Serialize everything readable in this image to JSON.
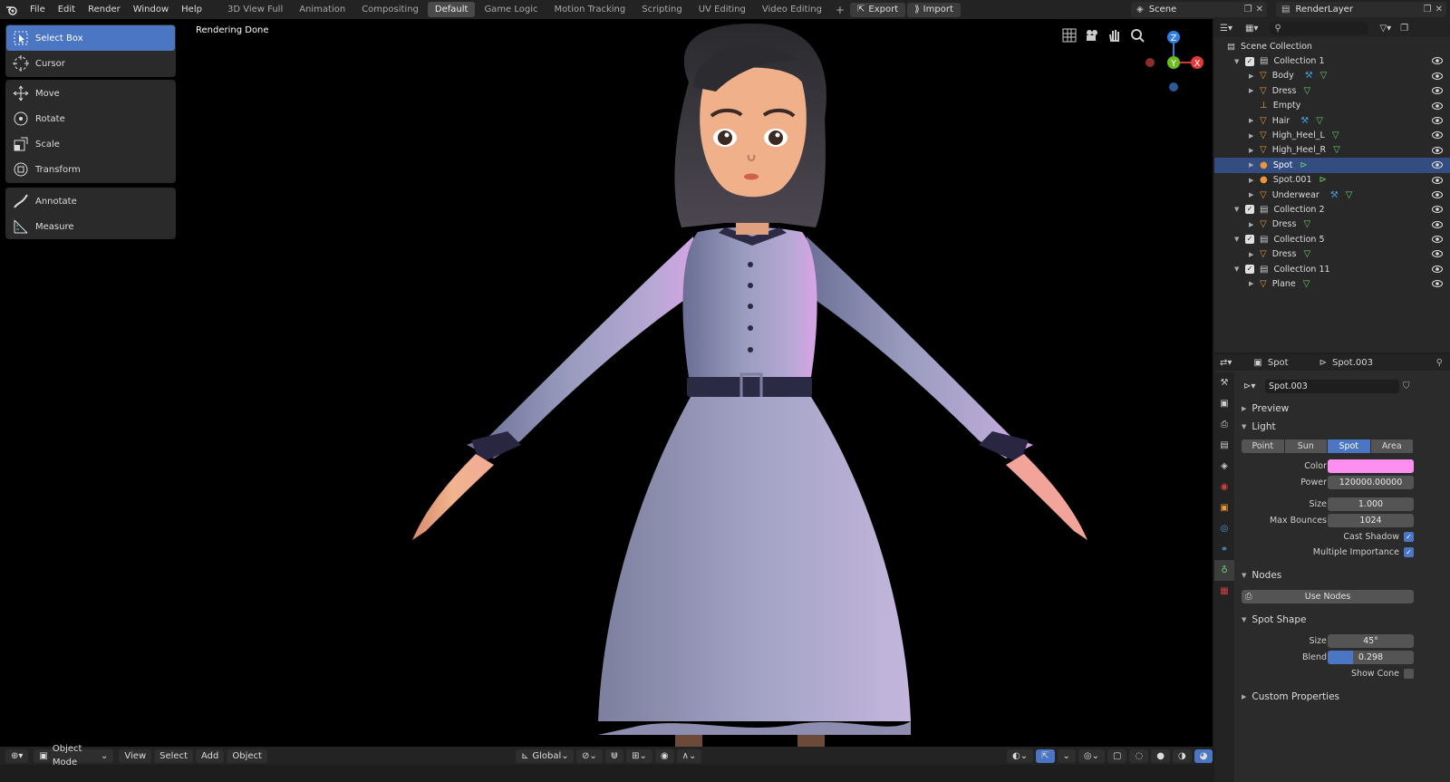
{
  "menubar": {
    "items": [
      "File",
      "Edit",
      "Render",
      "Window",
      "Help"
    ],
    "workspaces": [
      "3D View Full",
      "Animation",
      "Compositing",
      "Default",
      "Game Logic",
      "Motion Tracking",
      "Scripting",
      "UV Editing",
      "Video Editing"
    ],
    "active_workspace": "Default",
    "export_label": "Export",
    "import_label": "Import",
    "scene_name": "Scene",
    "render_layer": "RenderLayer"
  },
  "viewport": {
    "status": "Rendering Done",
    "gizmo": {
      "z": "Z",
      "y": "Y",
      "x": "X"
    }
  },
  "toolbar": {
    "select_box": "Select Box",
    "cursor": "Cursor",
    "move": "Move",
    "rotate": "Rotate",
    "scale": "Scale",
    "transform": "Transform",
    "annotate": "Annotate",
    "measure": "Measure"
  },
  "bottombar": {
    "mode": "Object Mode",
    "view": "View",
    "select": "Select",
    "add": "Add",
    "object": "Object",
    "orientation": "Global"
  },
  "outliner": {
    "root": "Scene Collection",
    "rows": [
      {
        "label": "Collection 1",
        "kind": "collection",
        "depth": 1
      },
      {
        "label": "Body",
        "kind": "mesh",
        "depth": 2,
        "mods": true
      },
      {
        "label": "Dress",
        "kind": "mesh",
        "depth": 2,
        "mods": false
      },
      {
        "label": "Empty",
        "kind": "empty",
        "depth": 2,
        "mods": false
      },
      {
        "label": "Hair",
        "kind": "mesh",
        "depth": 2,
        "mods": true
      },
      {
        "label": "High_Heel_L",
        "kind": "mesh",
        "depth": 2,
        "mods": false
      },
      {
        "label": "High_Heel_R",
        "kind": "mesh",
        "depth": 2,
        "mods": false
      },
      {
        "label": "Spot",
        "kind": "light",
        "depth": 2,
        "mods": false,
        "selected": true
      },
      {
        "label": "Spot.001",
        "kind": "light",
        "depth": 2,
        "mods": false
      },
      {
        "label": "Underwear",
        "kind": "mesh",
        "depth": 2,
        "mods": true
      },
      {
        "label": "Collection 2",
        "kind": "collection",
        "depth": 1
      },
      {
        "label": "Dress",
        "kind": "mesh",
        "depth": 2,
        "mods": false
      },
      {
        "label": "Collection 5",
        "kind": "collection",
        "depth": 1
      },
      {
        "label": "Dress",
        "kind": "mesh",
        "depth": 2,
        "mods": false
      },
      {
        "label": "Collection 11",
        "kind": "collection",
        "depth": 1
      },
      {
        "label": "Plane",
        "kind": "mesh",
        "depth": 2,
        "mods": false
      }
    ]
  },
  "properties": {
    "object_name": "Spot",
    "data_name": "Spot.003",
    "datablock": "Spot.003",
    "preview": "Preview",
    "light_panel": "Light",
    "light_types": [
      "Point",
      "Sun",
      "Spot",
      "Area"
    ],
    "active_light_type": "Spot",
    "color_label": "Color",
    "color_value": "#ff8ef2",
    "power_label": "Power",
    "power_value": "120000.00000",
    "size_label": "Size",
    "size_value": "1.000",
    "bounces_label": "Max Bounces",
    "bounces_value": "1024",
    "cast_shadow": "Cast Shadow",
    "multiple_importance": "Multiple Importance",
    "nodes_panel": "Nodes",
    "use_nodes": "Use Nodes",
    "spot_shape_panel": "Spot Shape",
    "spot_size_label": "Size",
    "spot_size_value": "45°",
    "blend_label": "Blend",
    "blend_value": "0.298",
    "blend_fraction": 0.298,
    "show_cone": "Show Cone",
    "custom_props": "Custom Properties"
  }
}
